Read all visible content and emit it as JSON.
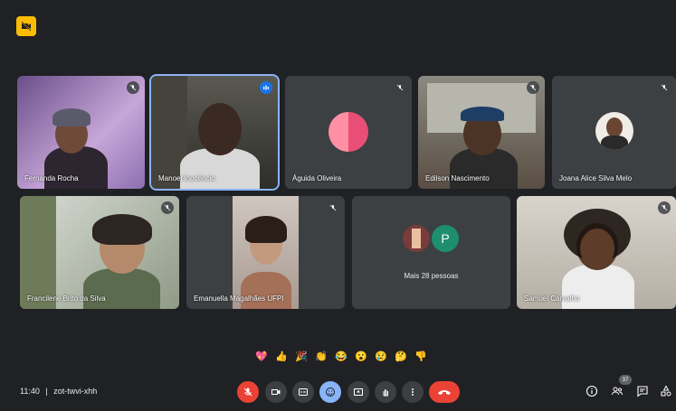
{
  "tiles": [
    {
      "name": "Fernanda Rocha"
    },
    {
      "name": "Manoel Inocêncio"
    },
    {
      "name": "Águida Oliveira"
    },
    {
      "name": "Edilson Nascimento"
    },
    {
      "name": "Joana Alice Silva Melo"
    },
    {
      "name": "Francilene Brito da Silva"
    },
    {
      "name": "Emanuella Magalhães UFPI"
    },
    {
      "name": "Samuel Carvalho"
    }
  ],
  "others_tile": {
    "avatar_letter": "P",
    "label": "Mais 28 pessoas"
  },
  "reactions": [
    "💖",
    "👍",
    "🎉",
    "👏",
    "😂",
    "😮",
    "😢",
    "🤔",
    "👎"
  ],
  "footer": {
    "time": "11:40",
    "separator": "|",
    "meeting_code": "zot-twvi-xhh",
    "participant_count": "37"
  },
  "colors": {
    "background": "#202124",
    "tile": "#3c4043",
    "accent_blue": "#8ab4f8",
    "red": "#ea4335",
    "badge_yellow": "#fbbc04"
  },
  "icons": [
    "mic-off-icon",
    "camera-icon",
    "captions-icon",
    "emoji-icon",
    "present-icon",
    "raise-hand-icon",
    "more-options-icon",
    "hang-up-icon",
    "info-icon",
    "people-icon",
    "chat-icon",
    "activities-icon"
  ]
}
